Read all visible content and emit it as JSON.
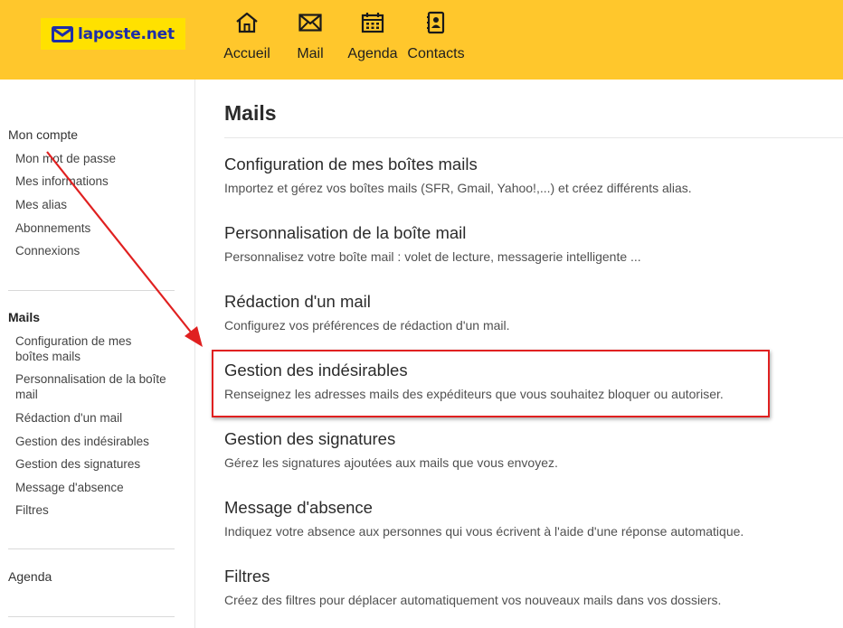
{
  "header": {
    "logo_text": "laposte.net",
    "nav": [
      {
        "label": "Accueil",
        "icon": "home-icon"
      },
      {
        "label": "Mail",
        "icon": "mail-icon"
      },
      {
        "label": "Agenda",
        "icon": "calendar-icon"
      },
      {
        "label": "Contacts",
        "icon": "contacts-icon"
      }
    ],
    "colors": {
      "bar": "#ffc72c",
      "logo_bg": "#ffe100",
      "logo_text": "#1d2ea8"
    }
  },
  "sidebar": {
    "account": {
      "heading": "Mon compte",
      "items": [
        "Mon mot de passe",
        "Mes informations",
        "Mes alias",
        "Abonnements",
        "Connexions"
      ]
    },
    "mails": {
      "heading": "Mails",
      "items": [
        "Configuration de mes boîtes mails",
        "Personnalisation de la boîte mail",
        "Rédaction d'un mail",
        "Gestion des indésirables",
        "Gestion des signatures",
        "Message d'absence",
        "Filtres"
      ]
    },
    "agenda": {
      "heading": "Agenda"
    }
  },
  "main": {
    "title": "Mails",
    "sections": [
      {
        "title": "Configuration de mes boîtes mails",
        "desc": "Importez et gérez vos boîtes mails (SFR, Gmail, Yahoo!,...) et créez différents alias."
      },
      {
        "title": "Personnalisation de la boîte mail",
        "desc": "Personnalisez votre boîte mail : volet de lecture, messagerie intelligente ..."
      },
      {
        "title": "Rédaction d'un mail",
        "desc": "Configurez vos préférences de rédaction d'un mail."
      },
      {
        "title": "Gestion des indésirables",
        "desc": "Renseignez les adresses mails des expéditeurs que vous souhaitez bloquer ou autoriser."
      },
      {
        "title": "Gestion des signatures",
        "desc": "Gérez les signatures ajoutées aux mails que vous envoyez."
      },
      {
        "title": "Message d'absence",
        "desc": "Indiquez votre absence aux personnes qui vous écrivent à l'aide d'une réponse automatique."
      },
      {
        "title": "Filtres",
        "desc": "Créez des filtres pour déplacer automatiquement vos nouveaux mails dans vos dossiers."
      }
    ]
  },
  "annotation": {
    "color": "#e02020",
    "highlighted_section": "Gestion des indésirables"
  }
}
